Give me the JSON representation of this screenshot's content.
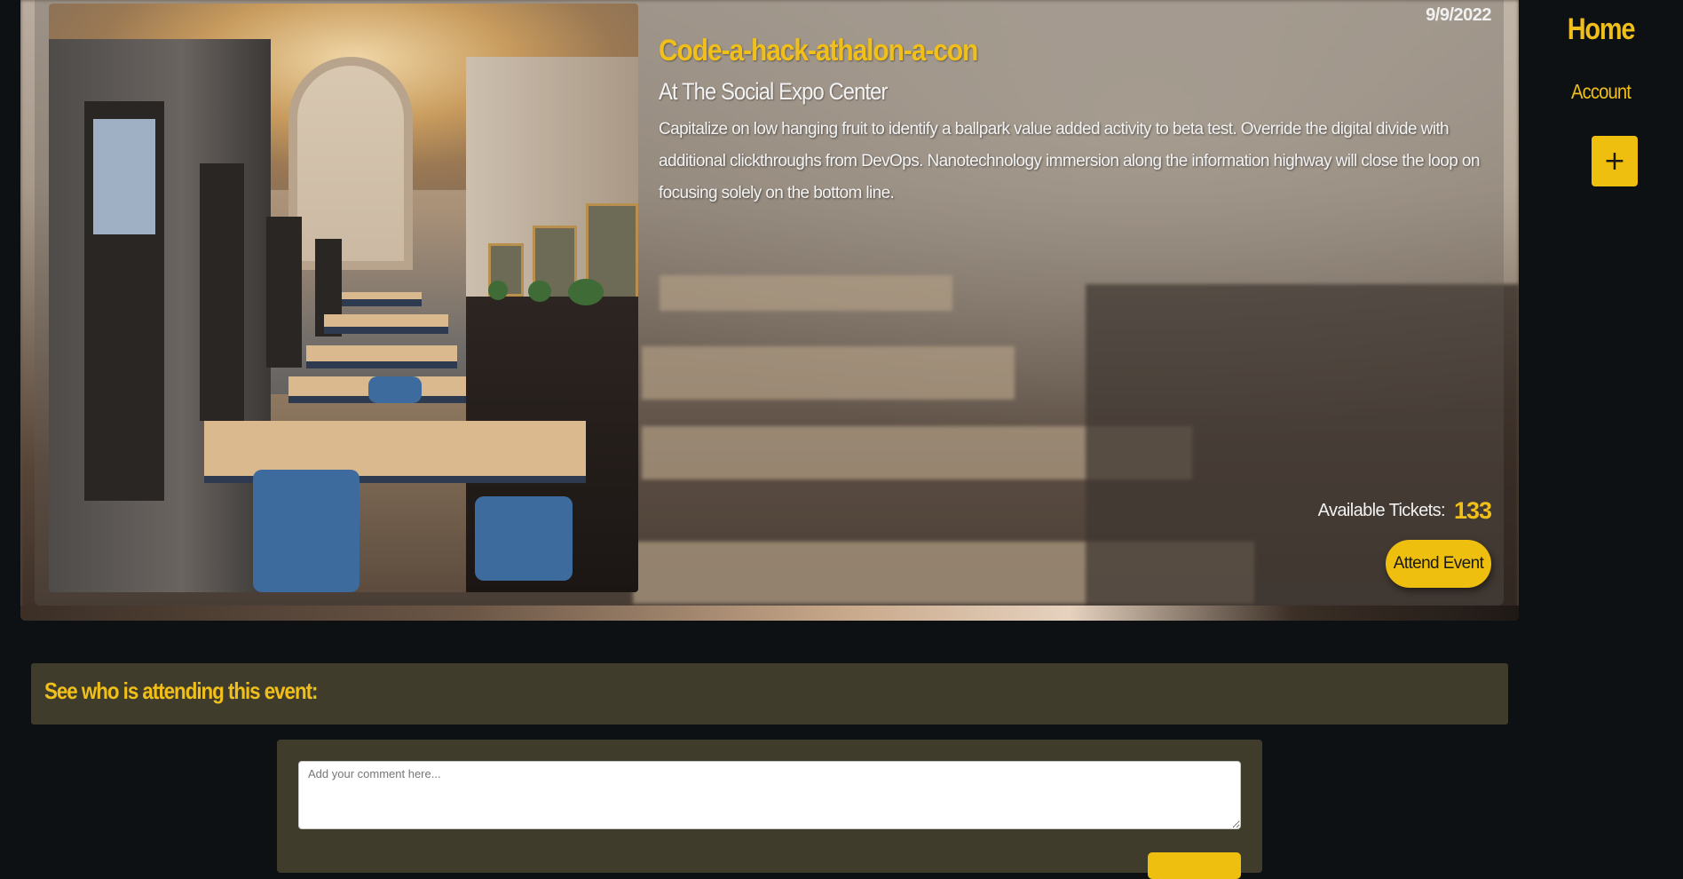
{
  "event": {
    "date": "9/9/2022",
    "title": "Code-a-hack-athalon-a-con",
    "venue": "At The Social Expo Center",
    "description": "Capitalize on low hanging fruit to identify a ballpark value added activity to beta test. Override the digital divide with additional clickthroughs from DevOps. Nanotechnology immersion along the information highway will close the loop on focusing solely on the bottom line.",
    "tickets_label": "Available Tickets:",
    "tickets_available": "133",
    "attend_label": "Attend Event"
  },
  "nav": {
    "home_label": "Home",
    "account_label": "Account",
    "add_label": "+"
  },
  "attendees": {
    "heading": "See who is attending this event:"
  },
  "comments": {
    "placeholder": "Add your comment here..."
  },
  "colors": {
    "accent": "#efbf0f",
    "background": "#0e1113",
    "panel": "#403c2c"
  }
}
